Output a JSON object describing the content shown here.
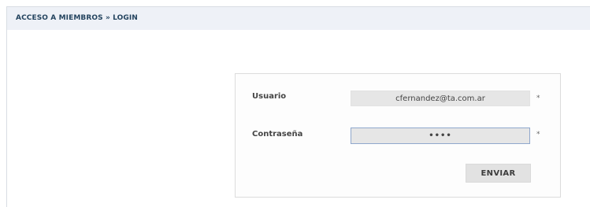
{
  "header": {
    "title": "ACCESO A MIEMBROS » LOGIN"
  },
  "login_form": {
    "username": {
      "label": "Usuario",
      "value": "cfernandez@ta.com.ar",
      "required_mark": "*"
    },
    "password": {
      "label": "Contraseña",
      "value": "••••",
      "required_mark": "*"
    },
    "submit_label": "ENVIAR"
  },
  "colors": {
    "header_background": "#eef1f7",
    "header_text": "#24445f",
    "input_background": "#e6e6e6",
    "focused_border": "#8fa7cc",
    "button_background": "#e2e2e2"
  }
}
